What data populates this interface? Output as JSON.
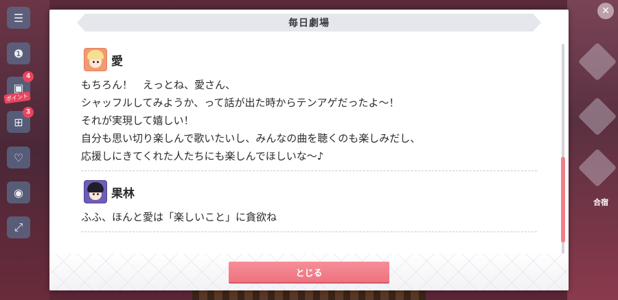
{
  "modal": {
    "title": "毎日劇場",
    "close_label": "とじる"
  },
  "entries": [
    {
      "speaker": "愛",
      "avatar_icon": "ai-portrait-icon",
      "lines": [
        "もちろん！　えっとね、愛さん、",
        "シャッフルしてみようか、って話が出た時からテンアゲだったよ～！",
        "それが実現して嬉しい！",
        "自分も思い切り楽しんで歌いたいし、みんなの曲を聴くのも楽しみだし、",
        "応援しにきてくれた人たちにも楽しんでほしいな～♪"
      ]
    },
    {
      "speaker": "果林",
      "avatar_icon": "karin-portrait-icon",
      "lines": [
        "ふふ、ほんと愛は「楽しいこと」に貪欲ね"
      ]
    }
  ],
  "background": {
    "badges": [
      "4",
      "3"
    ],
    "side_tag": "ポイント",
    "right_label": "合宿"
  },
  "colors": {
    "accent": "#f07f8a",
    "button": "#ee7380",
    "title_band": "#e6e7ec"
  }
}
